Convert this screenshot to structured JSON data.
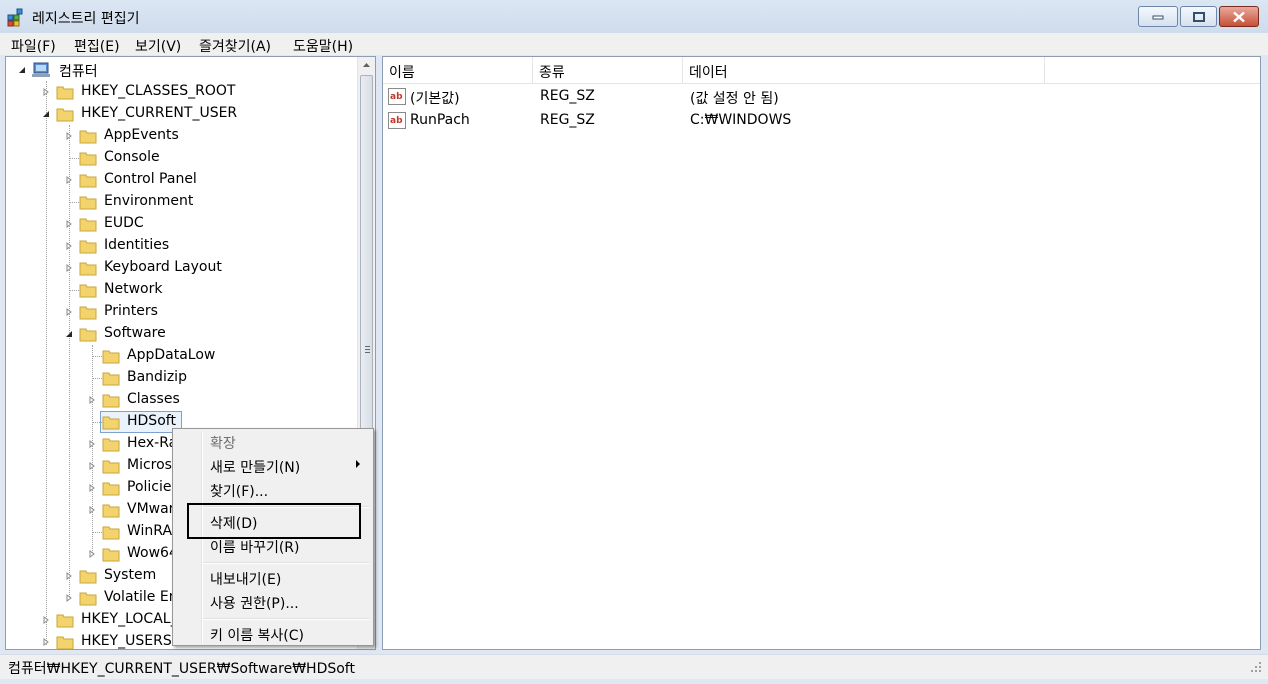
{
  "window": {
    "title": "레지스트리 편집기",
    "icon": "registry-editor-icon"
  },
  "menubar": {
    "items": [
      "파일(F)",
      "편집(E)",
      "보기(V)",
      "즐겨찾기(A)",
      "도움말(H)"
    ]
  },
  "tree": {
    "root": "컴퓨터",
    "hkcr": "HKEY_CLASSES_ROOT",
    "hkcu": "HKEY_CURRENT_USER",
    "hkcu_children": [
      "AppEvents",
      "Console",
      "Control Panel",
      "Environment",
      "EUDC",
      "Identities",
      "Keyboard Layout",
      "Network",
      "Printers",
      "Software"
    ],
    "software_children": [
      "AppDataLow",
      "Bandizip",
      "Classes",
      "HDSoft",
      "Hex-Ra",
      "Micros",
      "Policie",
      "VMwar",
      "WinRA",
      "Wow64"
    ],
    "after_software": [
      "System",
      "Volatile En"
    ],
    "hklm": "HKEY_LOCAL_",
    "hku": "HKEY_USERS",
    "selected": "HDSoft"
  },
  "values_pane": {
    "columns": [
      "이름",
      "종류",
      "데이터"
    ],
    "rows": [
      {
        "name": "(기본값)",
        "type": "REG_SZ",
        "data": "(값 설정 안 됨)"
      },
      {
        "name": "RunPach",
        "type": "REG_SZ",
        "data": "C:₩WINDOWS"
      }
    ]
  },
  "context_menu": {
    "expand": "확장",
    "new": "새로 만들기(N)",
    "find": "찾기(F)...",
    "delete": "삭제(D)",
    "rename": "이름 바꾸기(R)",
    "export": "내보내기(E)",
    "permissions": "사용 권한(P)...",
    "copy_key_name": "키 이름 복사(C)"
  },
  "statusbar": {
    "path": "컴퓨터₩HKEY_CURRENT_USER₩Software₩HDSoft"
  },
  "colors": {
    "title_bg": "#dbe6f3",
    "close_button": "#c75138",
    "selection_border": "#7da2ce",
    "folder_yellow": "#f3d36b"
  }
}
